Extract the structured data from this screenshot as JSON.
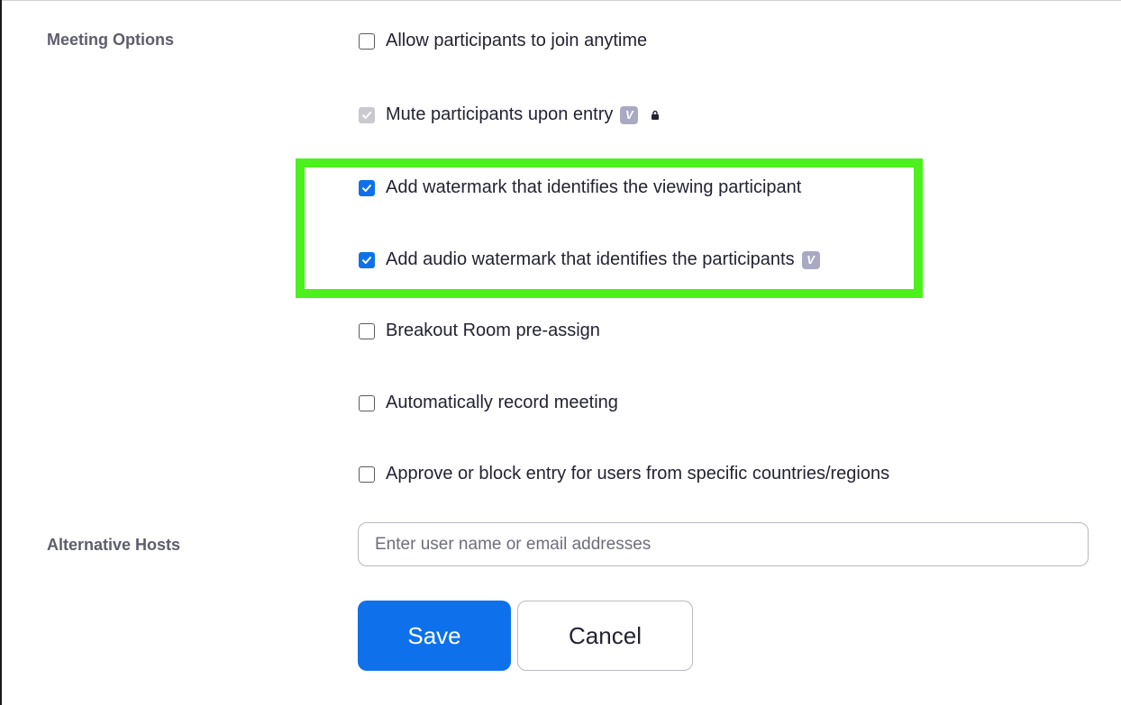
{
  "sections": {
    "meeting_options_label": "Meeting Options",
    "alternative_hosts_label": "Alternative Hosts"
  },
  "options": [
    {
      "label": "Allow participants to join anytime",
      "checked": false,
      "disabled": false,
      "badge": false,
      "locked": false
    },
    {
      "label": "Mute participants upon entry",
      "checked": true,
      "disabled": true,
      "badge": true,
      "locked": true
    },
    {
      "label": "Add watermark that identifies the viewing participant",
      "checked": true,
      "disabled": false,
      "badge": false,
      "locked": false
    },
    {
      "label": "Add audio watermark that identifies the participants",
      "checked": true,
      "disabled": false,
      "badge": true,
      "locked": false
    },
    {
      "label": "Breakout Room pre-assign",
      "checked": false,
      "disabled": false,
      "badge": false,
      "locked": false
    },
    {
      "label": "Automatically record meeting",
      "checked": false,
      "disabled": false,
      "badge": false,
      "locked": false
    },
    {
      "label": "Approve or block entry for users from specific countries/regions",
      "checked": false,
      "disabled": false,
      "badge": false,
      "locked": false
    }
  ],
  "alternative_hosts": {
    "value": "",
    "placeholder": "Enter user name or email addresses"
  },
  "buttons": {
    "save_label": "Save",
    "cancel_label": "Cancel"
  },
  "icons": {
    "vip_badge": "V",
    "lock": "lock-icon",
    "checkmark": "check-icon"
  },
  "colors": {
    "accent": "#0e71eb",
    "highlight": "#4cf01c",
    "label_gray": "#5d5d6e",
    "badge": "#a9a9c4"
  }
}
